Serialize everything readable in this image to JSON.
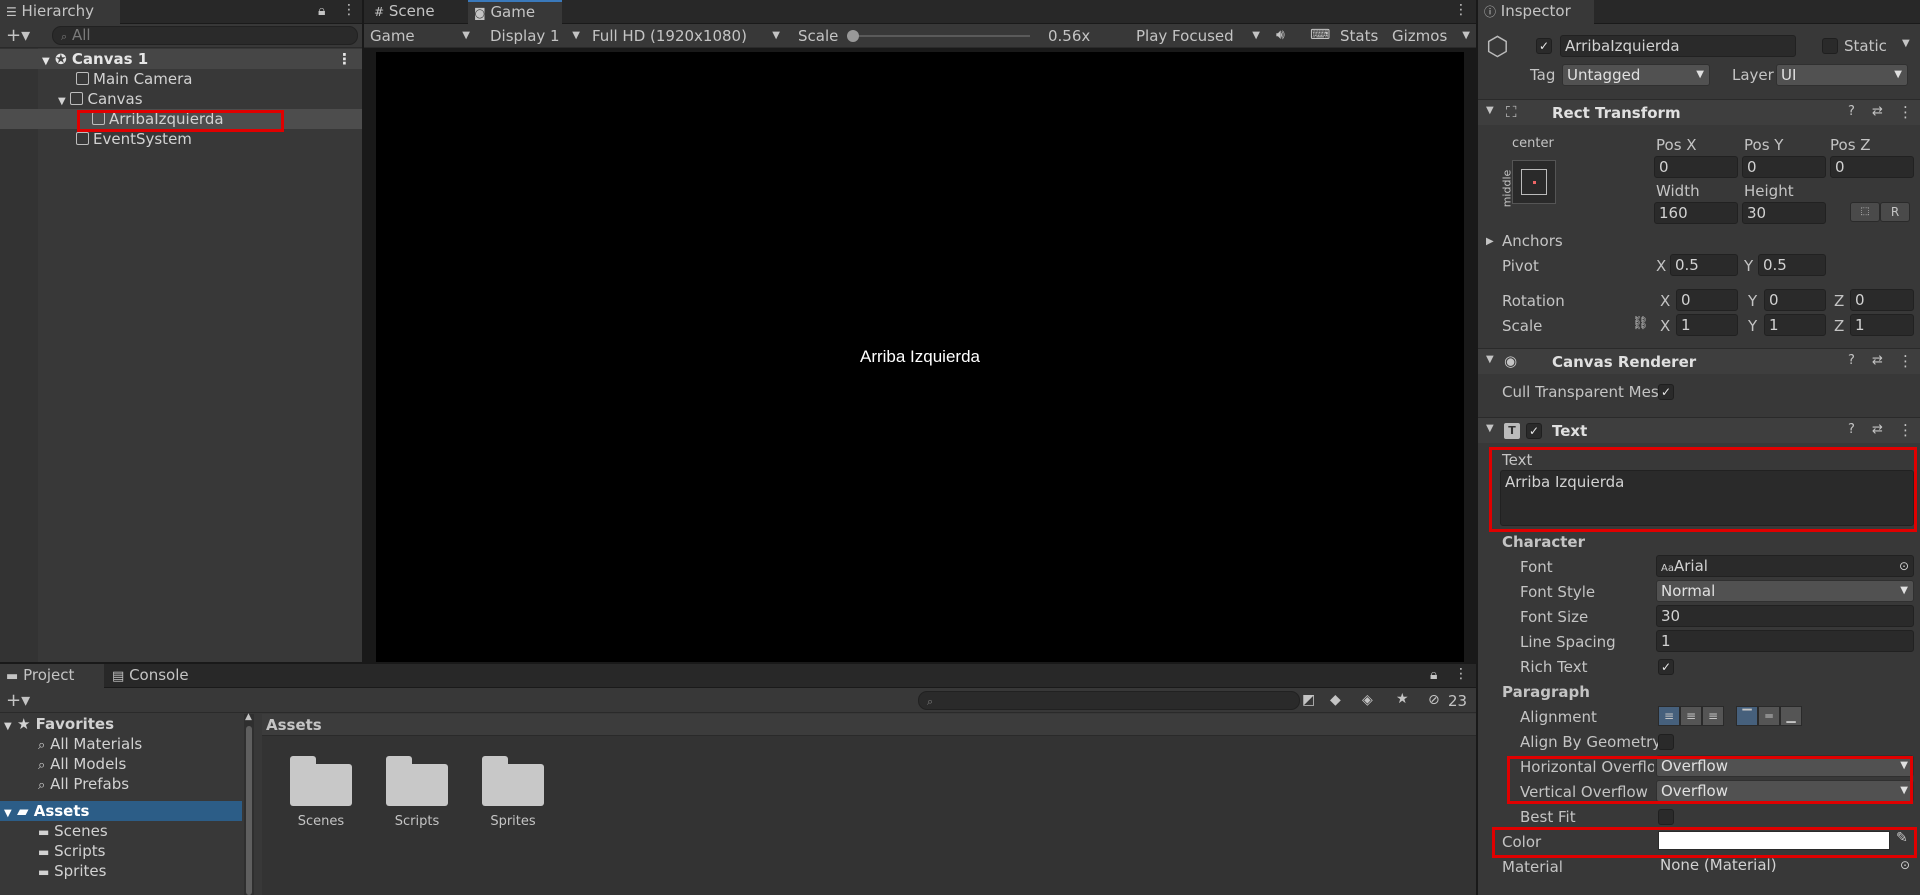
{
  "hierarchy": {
    "tab_label": "Hierarchy",
    "search_placeholder": "All",
    "items": [
      {
        "label": "Canvas 1"
      },
      {
        "label": "Main Camera"
      },
      {
        "label": "Canvas"
      },
      {
        "label": "ArribaIzquierda"
      },
      {
        "label": "EventSystem"
      }
    ]
  },
  "viewport": {
    "tabs": [
      {
        "label": "Scene"
      },
      {
        "label": "Game"
      }
    ],
    "toolbar": {
      "game_dropdown": "Game",
      "display_dropdown": "Display 1",
      "resolution_dropdown": "Full HD (1920x1080)",
      "scale_label": "Scale",
      "scale_value": "0.56x",
      "play_mode_dropdown": "Play Focused",
      "stats_label": "Stats",
      "gizmos_label": "Gizmos"
    },
    "game_text": "Arriba Izquierda"
  },
  "project": {
    "tabs": [
      {
        "label": "Project"
      },
      {
        "label": "Console"
      }
    ],
    "favorites_label": "Favorites",
    "favorites": [
      {
        "label": "All Materials"
      },
      {
        "label": "All Models"
      },
      {
        "label": "All Prefabs"
      }
    ],
    "assets_label": "Assets",
    "asset_folders": [
      {
        "label": "Scenes"
      },
      {
        "label": "Scripts"
      },
      {
        "label": "Sprites"
      }
    ],
    "breadcrumb": "Assets",
    "hidden_count": "23"
  },
  "inspector": {
    "tab_label": "Inspector",
    "object_name": "ArribaIzquierda",
    "static_label": "Static",
    "tag_label": "Tag",
    "tag_value": "Untagged",
    "layer_label": "Layer",
    "layer_value": "UI",
    "rect_transform": {
      "title": "Rect Transform",
      "anchor_h": "center",
      "anchor_v": "middle",
      "pos_x_label": "Pos X",
      "pos_x": "0",
      "pos_y_label": "Pos Y",
      "pos_y": "0",
      "pos_z_label": "Pos Z",
      "pos_z": "0",
      "width_label": "Width",
      "width": "160",
      "height_label": "Height",
      "height": "30",
      "anchors_label": "Anchors",
      "pivot_label": "Pivot",
      "pivot_x": "0.5",
      "pivot_y": "0.5",
      "rotation_label": "Rotation",
      "rot_x": "0",
      "rot_y": "0",
      "rot_z": "0",
      "scale_label": "Scale",
      "scale_x": "1",
      "scale_y": "1",
      "scale_z": "1",
      "x": "X",
      "y": "Y",
      "z": "Z",
      "r_button": "R"
    },
    "canvas_renderer": {
      "title": "Canvas Renderer",
      "cull_label": "Cull Transparent Mes"
    },
    "text": {
      "title": "Text",
      "text_label": "Text",
      "text_value": "Arriba Izquierda",
      "character_label": "Character",
      "font_label": "Font",
      "font_value": "Arial",
      "font_style_label": "Font Style",
      "font_style_value": "Normal",
      "font_size_label": "Font Size",
      "font_size_value": "30",
      "line_spacing_label": "Line Spacing",
      "line_spacing_value": "1",
      "rich_text_label": "Rich Text",
      "paragraph_label": "Paragraph",
      "alignment_label": "Alignment",
      "align_geometry_label": "Align By Geometry",
      "h_overflow_label": "Horizontal Overflow",
      "h_overflow_value": "Overflow",
      "v_overflow_label": "Vertical Overflow",
      "v_overflow_value": "Overflow",
      "best_fit_label": "Best Fit",
      "color_label": "Color",
      "color_value": "#ffffff",
      "material_label": "Material",
      "material_value": "None (Material)"
    }
  },
  "colors": {
    "highlight": "#e00000",
    "selection": "#2c5d87",
    "accent": "#3a79bb"
  }
}
